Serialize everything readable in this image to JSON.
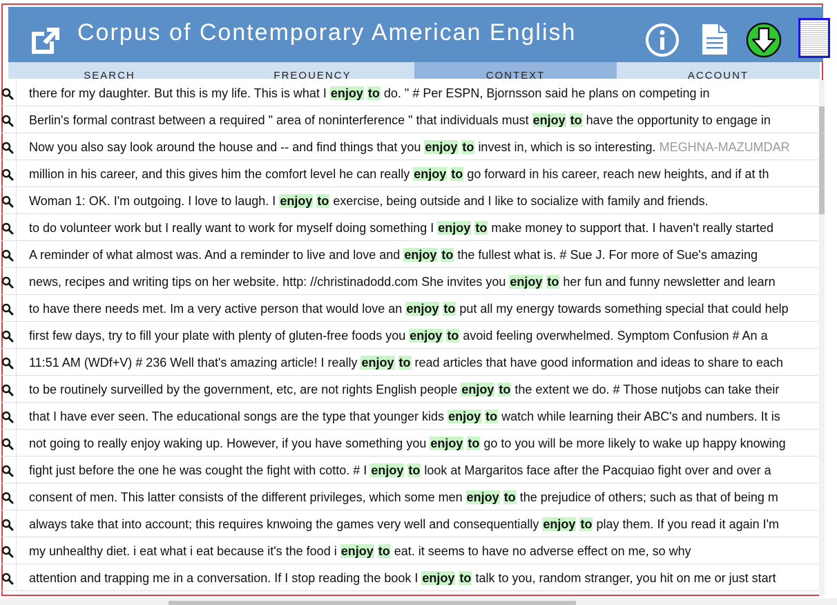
{
  "header": {
    "title": "Corpus of Contemporary American English",
    "bg_color": "#5b8fc8",
    "icons": [
      "external-link-icon",
      "info-icon",
      "document-icon",
      "download-icon",
      "page-thumbnail-icon"
    ]
  },
  "tabs": [
    "SEARCH",
    "FREQUENCY",
    "CONTEXT",
    "ACCOUNT"
  ],
  "active_tab": "CONTEXT",
  "highlight_color": "#c9f5c9",
  "results": [
    {
      "left": "there for my daughter. But this is my life. This is what I",
      "kw1": "enjoy",
      "kw2": "to",
      "right": "do. \" # Per ESPN, Bjornsson said he plans on competing in"
    },
    {
      "left": "Berlin's formal contrast between a required \" area of noninterference \" that individuals must",
      "kw1": "enjoy",
      "kw2": "to",
      "right": "have the opportunity to engage in"
    },
    {
      "left": "Now you also say look around the house and -- and find things that you",
      "kw1": "enjoy",
      "kw2": "to",
      "right": "invest in, which is so interesting.",
      "speaker": "MEGHNA-MAZUMDAR"
    },
    {
      "left": "million in his career, and this gives him the comfort level he can really",
      "kw1": "enjoy",
      "kw2": "to",
      "right": "go forward in his career, reach new heights, and if at th"
    },
    {
      "left": "Woman 1: OK. I'm outgoing. I love to laugh. I",
      "kw1": "enjoy",
      "kw2": "to",
      "right": "exercise, being outside and I like to socialize with family and friends."
    },
    {
      "left": "to do volunteer work but I really want to work for myself doing something I",
      "kw1": "enjoy",
      "kw2": "to",
      "right": "make money to support that. I haven't really started"
    },
    {
      "left": "A reminder of what almost was. And a reminder to live and love and",
      "kw1": "enjoy",
      "kw2": "to",
      "right": "the fullest what is. # Sue J. For more of Sue's amazing"
    },
    {
      "left": "news, recipes and writing tips on her website. http: //christinadodd.com She invites you",
      "kw1": "enjoy",
      "kw2": "to",
      "right": "her fun and funny newsletter and learn"
    },
    {
      "left": "to have there needs met. Im a very active person that would love an",
      "kw1": "enjoy",
      "kw2": "to",
      "right": "put all my energy towards something special that could help"
    },
    {
      "left": "first few days, try to fill your plate with plenty of gluten-free foods you",
      "kw1": "enjoy",
      "kw2": "to",
      "right": "avoid feeling overwhelmed. Symptom Confusion # An a"
    },
    {
      "left": "11:51 AM (WDf+V) # 236 Well that's amazing article! I really",
      "kw1": "enjoy",
      "kw2": "to",
      "right": "read articles that have good information and ideas to share to each"
    },
    {
      "left": "to be routinely surveilled by the government, etc, are not rights English people",
      "kw1": "enjoy",
      "kw2": "to",
      "right": "the extent we do. # Those nutjobs can take their"
    },
    {
      "left": "that I have ever seen. The educational songs are the type that younger kids",
      "kw1": "enjoy",
      "kw2": "to",
      "right": "watch while learning their ABC's and numbers. It is"
    },
    {
      "left": "not going to really enjoy waking up. However, if you have something you",
      "kw1": "enjoy",
      "kw2": "to",
      "right": "go to you will be more likely to wake up happy knowing"
    },
    {
      "left": "fight just before the one he was cought the fight with cotto. # I",
      "kw1": "enjoy",
      "kw2": "to",
      "right": "look at Margaritos face after the Pacquiao fight over and over a"
    },
    {
      "left": "consent of men. This latter consists of the different privileges, which some men",
      "kw1": "enjoy",
      "kw2": "to",
      "right": "the prejudice of others; such as that of being m"
    },
    {
      "left": "always take that into account; this requires knwoing the games very well and consequentially",
      "kw1": "enjoy",
      "kw2": "to",
      "right": "play them. If you read it again I'm"
    },
    {
      "left": "my unhealthy diet. i eat what i eat because it's the food i",
      "kw1": "enjoy",
      "kw2": "to",
      "right": "eat. it seems to have no adverse effect on me, so why"
    },
    {
      "left": "attention and trapping me in a conversation. If I stop reading the book I",
      "kw1": "enjoy",
      "kw2": "to",
      "right": "talk to you, random stranger, you hit on me or just start"
    }
  ]
}
